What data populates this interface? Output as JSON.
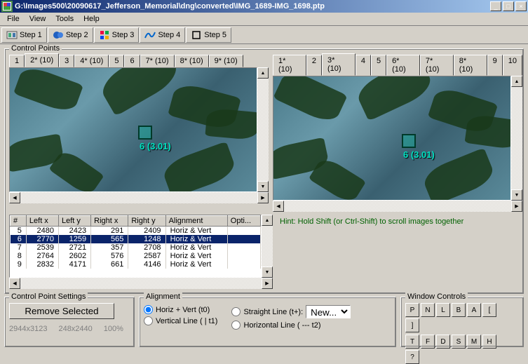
{
  "window": {
    "title": "G:\\Images500\\20090617_Jefferson_Memorial\\dng\\converted\\IMG_1689-IMG_1698.ptp"
  },
  "menu": {
    "file": "File",
    "view": "View",
    "tools": "Tools",
    "help": "Help"
  },
  "toolbar": {
    "step1": "Step 1",
    "step2": "Step 2",
    "step3": "Step 3",
    "step4": "Step 4",
    "step5": "Step 5"
  },
  "panel": {
    "title": "Control Points",
    "left_tabs": [
      "1",
      "2* (10)",
      "3",
      "4* (10)",
      "5",
      "6",
      "7* (10)",
      "8* (10)",
      "9* (10)"
    ],
    "left_active_idx": 1,
    "right_tabs": [
      "1* (10)",
      "2",
      "3* (10)",
      "4",
      "5",
      "6* (10)",
      "7* (10)",
      "8* (10)",
      "9",
      "10"
    ],
    "right_active_idx": 2,
    "cp_label": "6 (3.01)"
  },
  "table": {
    "headers": [
      "#",
      "Left x",
      "Left y",
      "Right x",
      "Right y",
      "Alignment",
      "Opti..."
    ],
    "rows": [
      {
        "n": "5",
        "lx": "2480",
        "ly": "2423",
        "rx": "291",
        "ry": "2409",
        "al": "Horiz & Vert"
      },
      {
        "n": "6",
        "lx": "2770",
        "ly": "1259",
        "rx": "565",
        "ry": "1248",
        "al": "Horiz & Vert"
      },
      {
        "n": "7",
        "lx": "2539",
        "ly": "2721",
        "rx": "357",
        "ry": "2708",
        "al": "Horiz & Vert"
      },
      {
        "n": "8",
        "lx": "2764",
        "ly": "2602",
        "rx": "576",
        "ry": "2587",
        "al": "Horiz & Vert"
      },
      {
        "n": "9",
        "lx": "2832",
        "ly": "4171",
        "rx": "661",
        "ry": "4146",
        "al": "Horiz & Vert"
      }
    ],
    "selected_idx": 1
  },
  "hint": "Hint: Hold Shift (or Ctrl-Shift) to scroll images together",
  "cps": {
    "title": "Control Point Settings",
    "remove": "Remove Selected",
    "dim_left": "2944x3123",
    "dim_right": "248x2440",
    "zoom": "100%"
  },
  "alignment": {
    "title": "Alignment",
    "opts": {
      "hv": "Horiz + Vert (t0)",
      "sl": "Straight Line (t+):",
      "vl": "Vertical Line ( | t1)",
      "hl": "Horizontal Line ( --- t2)"
    },
    "select_value": "New..."
  },
  "wc": {
    "title": "Window Controls",
    "row1": [
      "P",
      "N",
      "L",
      "B",
      "A",
      "[",
      "]"
    ],
    "row2": [
      "T",
      "F",
      "D",
      "S",
      "M",
      "H",
      "?"
    ]
  }
}
